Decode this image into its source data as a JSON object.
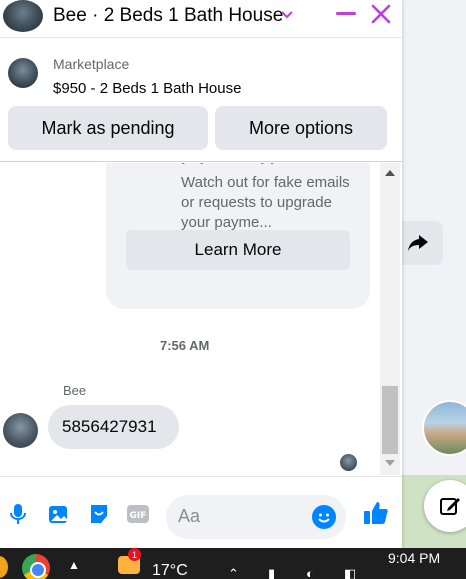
{
  "header": {
    "title": "Bee · 2 Beds 1 Bath House",
    "accent_color": "#bc3fe0"
  },
  "listing": {
    "source": "Marketplace",
    "title": "$950 - 2 Beds 1 Bath House",
    "mark_pending_label": "Mark as pending",
    "more_options_label": "More options"
  },
  "thread": {
    "card_text": "Watch out for fake emails or requests to upgrade your payme...",
    "learn_more_label": "Learn More",
    "timestamp": "7:56 AM",
    "sender_name": "Bee",
    "message": "5856427931"
  },
  "composer": {
    "placeholder": "Aa",
    "accent_color": "#0084ff",
    "icons": [
      "microphone-icon",
      "photo-icon",
      "sticker-icon",
      "gif-icon",
      "emoji-icon",
      "like-icon"
    ]
  },
  "taskbar": {
    "notification_count": "1",
    "temperature": "17°C",
    "time": "9:04 PM"
  }
}
